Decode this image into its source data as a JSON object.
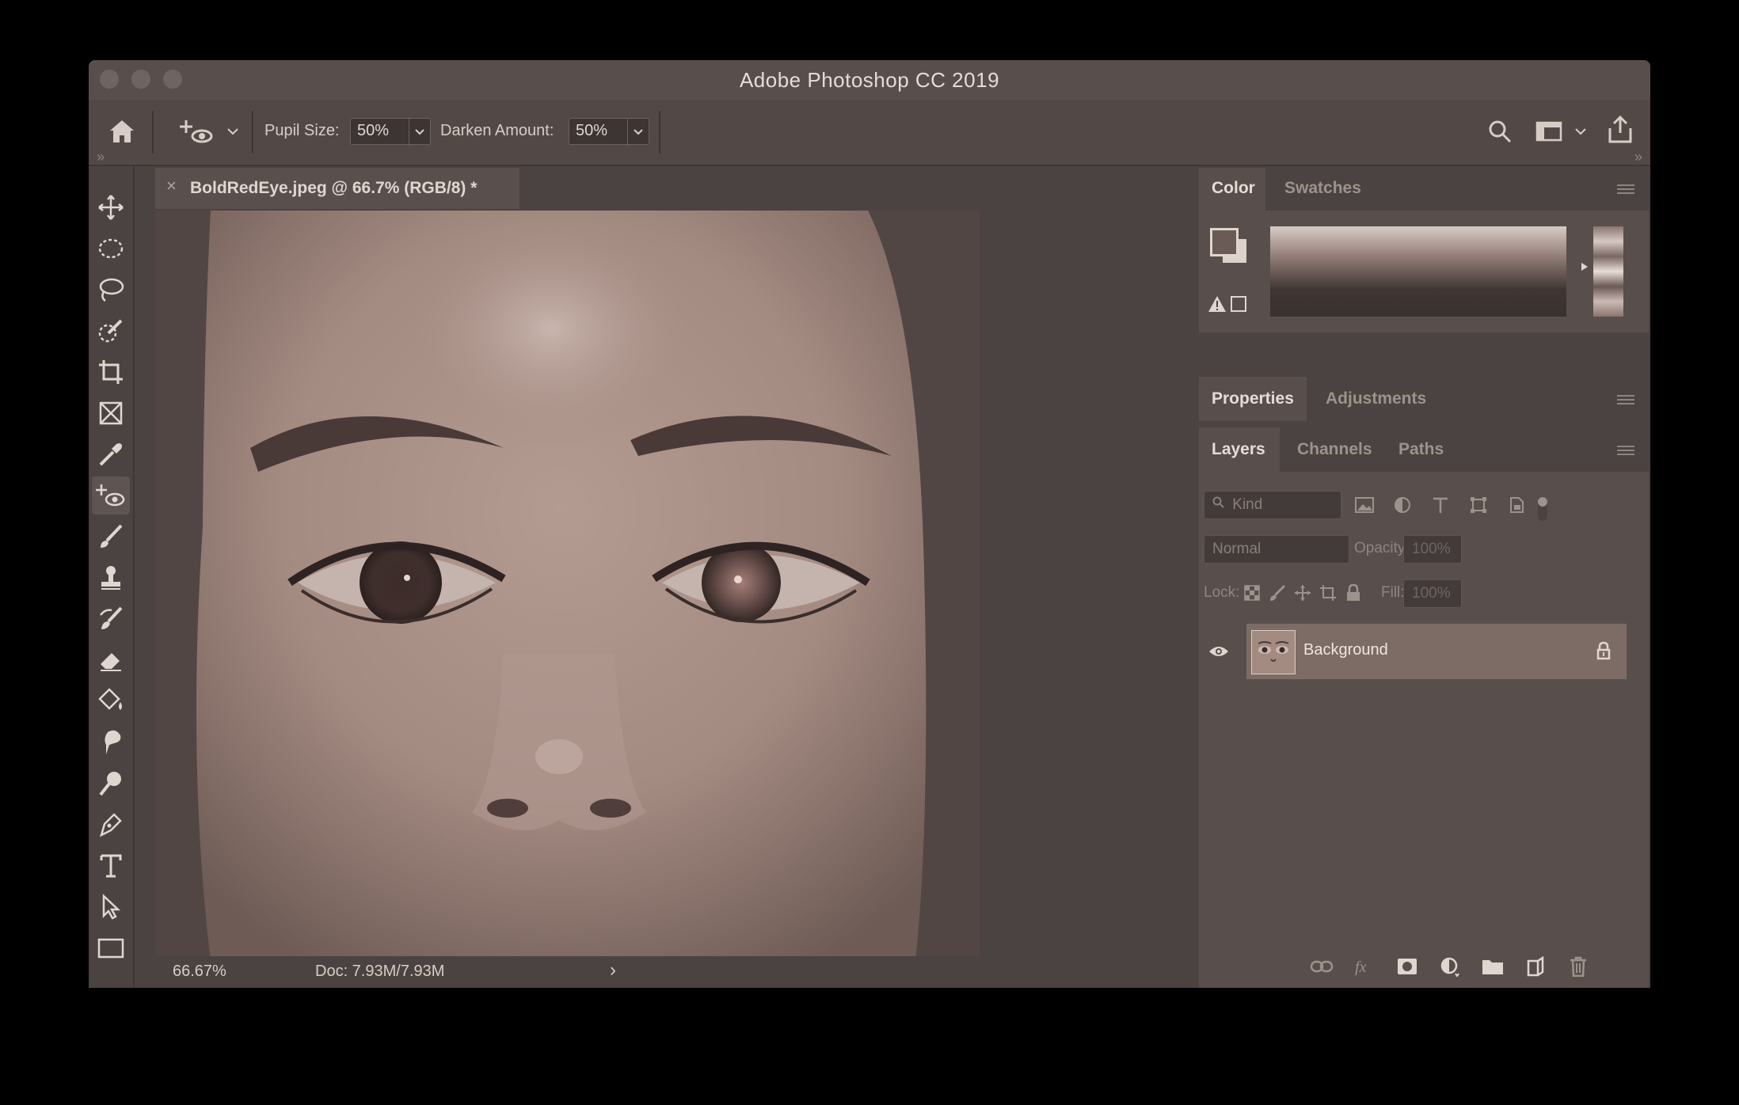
{
  "app": {
    "title": "Adobe Photoshop CC 2019"
  },
  "options": {
    "pupil_label": "Pupil Size:",
    "pupil_value": "50%",
    "darken_label": "Darken Amount:",
    "darken_value": "50%"
  },
  "document": {
    "tab_label": "BoldRedEye.jpeg @ 66.7% (RGB/8) *",
    "close_glyph": "×"
  },
  "status": {
    "zoom": "66.67%",
    "doc": "Doc: 7.93M/7.93M",
    "arrow": "›"
  },
  "collapse": {
    "left": "»",
    "right": "»"
  },
  "panels": {
    "color_tabs": [
      "Color",
      "Swatches"
    ],
    "props_tabs": [
      "Properties",
      "Adjustments"
    ],
    "layers_tabs": [
      "Layers",
      "Channels",
      "Paths"
    ],
    "filter": {
      "kind": "Kind"
    },
    "blend": {
      "mode": "Normal",
      "opacity_label": "Opacity:",
      "opacity_value": "100%"
    },
    "lock": {
      "label": "Lock:",
      "fill_label": "Fill:",
      "fill_value": "100%"
    },
    "layers": [
      {
        "name": "Background",
        "visible": true,
        "locked": true
      }
    ]
  },
  "colors": {
    "window_bg": "#4b4341",
    "selected_layer": "#7d6b66",
    "skin": "#a48b82"
  }
}
